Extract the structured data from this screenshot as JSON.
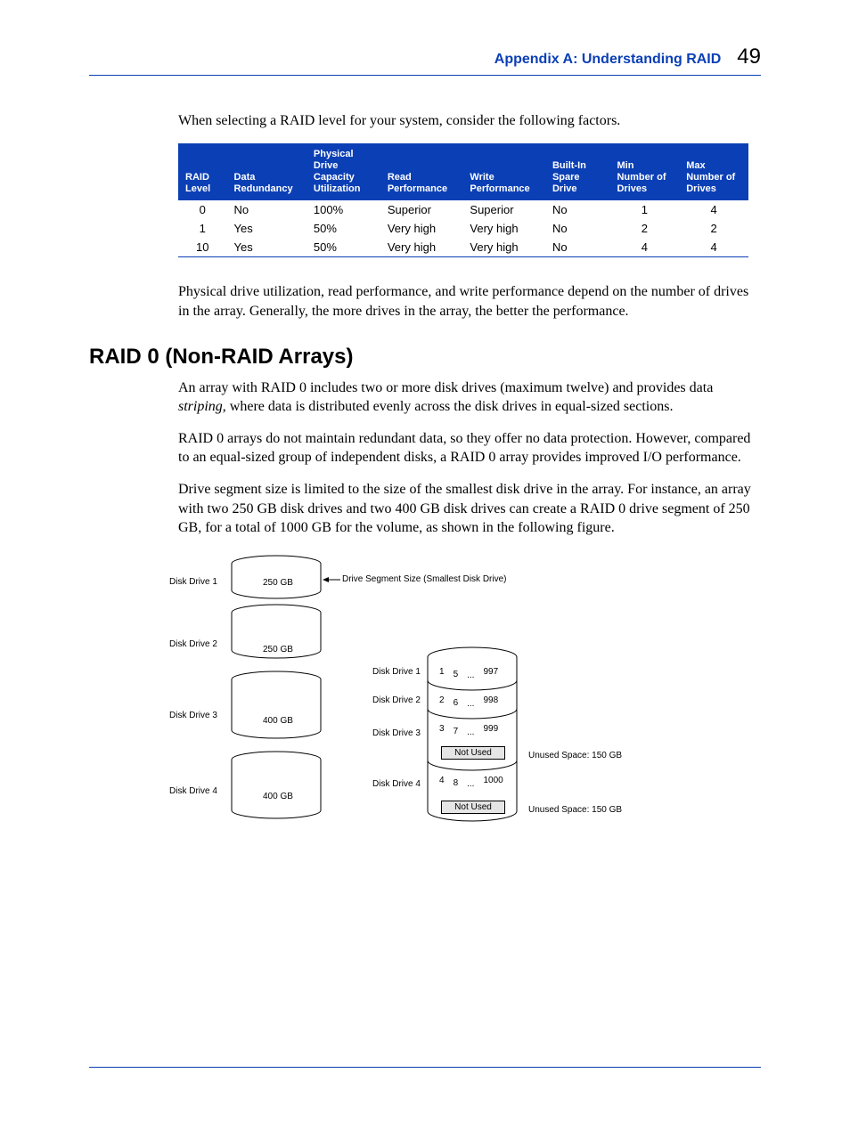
{
  "header": {
    "appendix": "Appendix A: Understanding RAID",
    "page_number": "49"
  },
  "intro_para": "When selecting a RAID level for your system, consider the following factors.",
  "table": {
    "headers": [
      "RAID Level",
      "Data Redundancy",
      "Physical Drive Capacity Utilization",
      "Read Performance",
      "Write Performance",
      "Built-In Spare Drive",
      "Min Number of Drives",
      "Max Number of Drives"
    ],
    "rows": [
      [
        "0",
        "No",
        "100%",
        "Superior",
        "Superior",
        "No",
        "1",
        "4"
      ],
      [
        "1",
        "Yes",
        "50%",
        "Very high",
        "Very high",
        "No",
        "2",
        "2"
      ],
      [
        "10",
        "Yes",
        "50%",
        "Very high",
        "Very high",
        "No",
        "4",
        "4"
      ]
    ]
  },
  "after_table_para": "Physical drive utilization, read performance, and write performance depend on the number of drives in the array. Generally, the more drives in the array, the better the performance.",
  "section_heading": "RAID 0 (Non-RAID Arrays)",
  "para1_a": "An array with RAID 0 includes two or more disk drives (maximum twelve) and provides data ",
  "para1_term": "striping",
  "para1_b": ", where data is distributed evenly across the disk drives in equal-sized sections.",
  "para2": "RAID 0 arrays do not maintain redundant data, so they offer no data protection. However, compared to an equal-sized group of independent disks, a RAID 0 array provides improved I/O performance.",
  "para3": "Drive segment size is limited to the size of the smallest disk drive in the array. For instance, an array with two 250 GB disk drives and two 400 GB disk drives can create a RAID 0 drive segment of 250 GB, for a total of 1000 GB for the volume, as shown in the following figure.",
  "figure": {
    "drive_labels": [
      "Disk Drive 1",
      "Disk Drive 2",
      "Disk Drive 3",
      "Disk Drive 4"
    ],
    "drive_caps": [
      "250 GB",
      "250 GB",
      "400 GB",
      "400 GB"
    ],
    "segment_label": "Drive Segment Size (Smallest Disk Drive)",
    "right_drive_labels": [
      "Disk Drive 1",
      "Disk Drive 2",
      "Disk Drive 3",
      "Disk Drive 4"
    ],
    "seg_rows": [
      [
        "1",
        "5",
        "...",
        "997"
      ],
      [
        "2",
        "6",
        "...",
        "998"
      ],
      [
        "3",
        "7",
        "...",
        "999"
      ],
      [
        "4",
        "8",
        "...",
        "1000"
      ]
    ],
    "not_used": "Not Used",
    "unused_label": "Unused Space: 150 GB"
  }
}
